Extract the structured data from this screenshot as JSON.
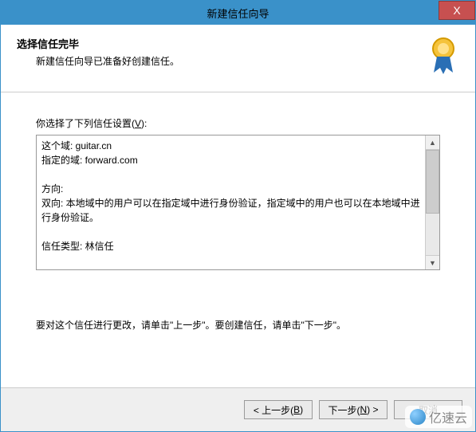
{
  "window": {
    "title": "新建信任向导",
    "close_glyph": "X"
  },
  "header": {
    "title": "选择信任完毕",
    "subtitle": "新建信任向导已准备好创建信任。"
  },
  "content": {
    "settings_label_prefix": "你选择了下列信任设置(",
    "settings_label_mnemonic": "V",
    "settings_label_suffix": "):",
    "details_text": "这个域: guitar.cn\n指定的域: forward.com\n\n方向:\n双向: 本地域中的用户可以在指定域中进行身份验证，指定域中的用户也可以在本地域中进行身份验证。\n\n信任类型: 林信任",
    "instruction": "要对这个信任进行更改，请单击\"上一步\"。要创建信任，请单击\"下一步\"。"
  },
  "buttons": {
    "back_prefix": "< 上一步(",
    "back_mnemonic": "B",
    "back_suffix": ")",
    "next_prefix": "下一步(",
    "next_mnemonic": "N",
    "next_suffix": ") >",
    "cancel": "取消"
  },
  "watermark": {
    "text": "亿速云"
  },
  "scroll": {
    "up": "▲",
    "down": "▼"
  }
}
